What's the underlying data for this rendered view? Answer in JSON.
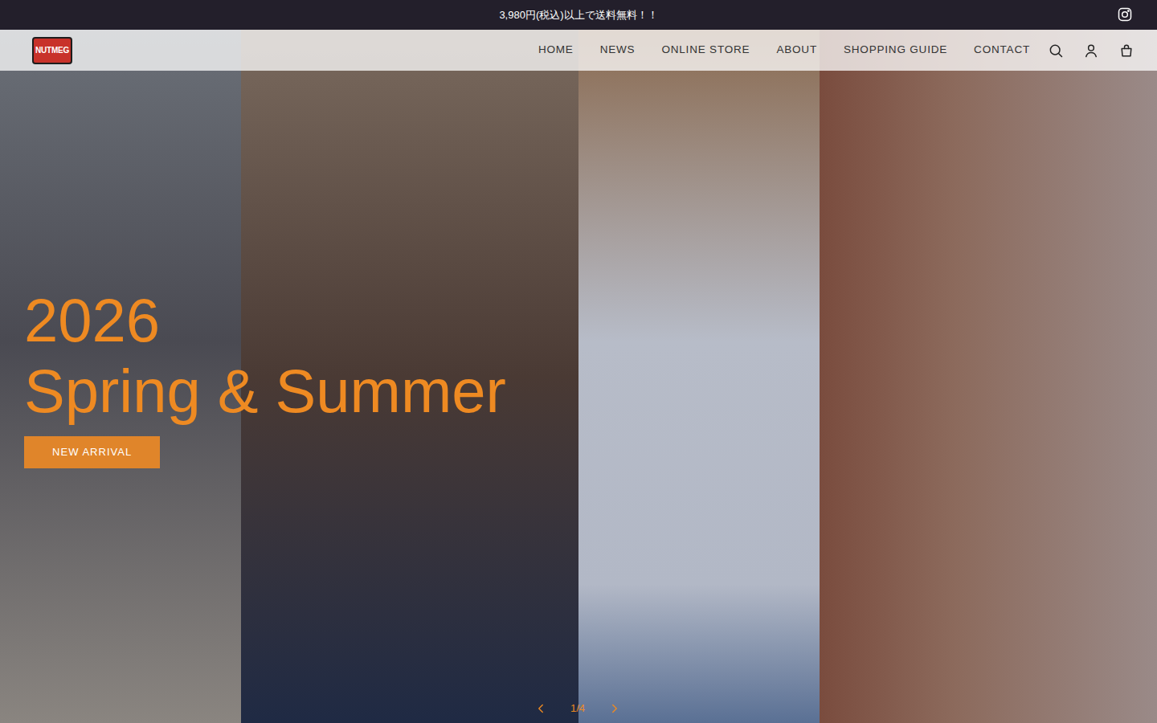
{
  "announcement": {
    "text": "3,980円(税込)以上で送料無料！！"
  },
  "logo": {
    "text": "NUTMEG"
  },
  "nav": {
    "items": [
      {
        "label": "HOME"
      },
      {
        "label": "NEWS"
      },
      {
        "label": "ONLINE STORE"
      },
      {
        "label": "ABOUT"
      },
      {
        "label": "SHOPPING GUIDE"
      },
      {
        "label": "CONTACT"
      }
    ]
  },
  "hero": {
    "year": "2026",
    "title": "Spring & Summer",
    "button": "NEW ARRIVAL",
    "counter": "1/4"
  }
}
